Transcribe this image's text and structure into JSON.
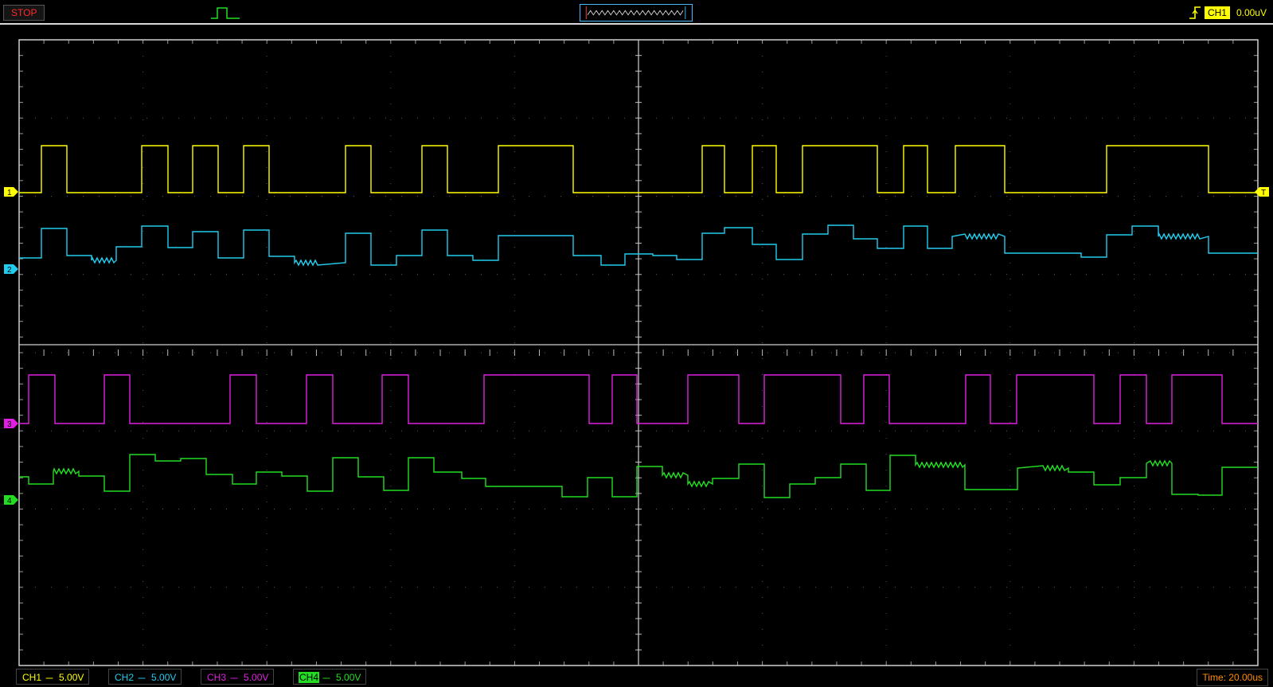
{
  "toolbar": {
    "run_state": "STOP",
    "trigger_mode_icon": "single-pulse-icon",
    "trigger_edge_icon": "rising-edge-icon",
    "trigger_source": "CH1",
    "trigger_level": "0.00uV"
  },
  "markers": {
    "ch1": "1",
    "ch2": "2",
    "ch3": "3",
    "ch4": "4",
    "trigger": "T"
  },
  "channels": [
    {
      "name": "CH1",
      "coupling": "---",
      "scale": "5.00V",
      "color": "#ffff00"
    },
    {
      "name": "CH2",
      "coupling": "---",
      "scale": "5.00V",
      "color": "#22ccee"
    },
    {
      "name": "CH3",
      "coupling": "---",
      "scale": "5.00V",
      "color": "#e020e0"
    },
    {
      "name": "CH4",
      "coupling": "---",
      "scale": "5.00V",
      "color": "#22dd22"
    }
  ],
  "timebase": "Time: 20.00us",
  "colors": {
    "grid": "#5a5a5a",
    "border": "#cfcfcf",
    "ch1": "#ffff00",
    "ch2": "#22ccee",
    "ch3": "#e020e0",
    "ch4": "#22dd22",
    "time": "#ff8c00",
    "stop": "#ff2a2a"
  }
}
